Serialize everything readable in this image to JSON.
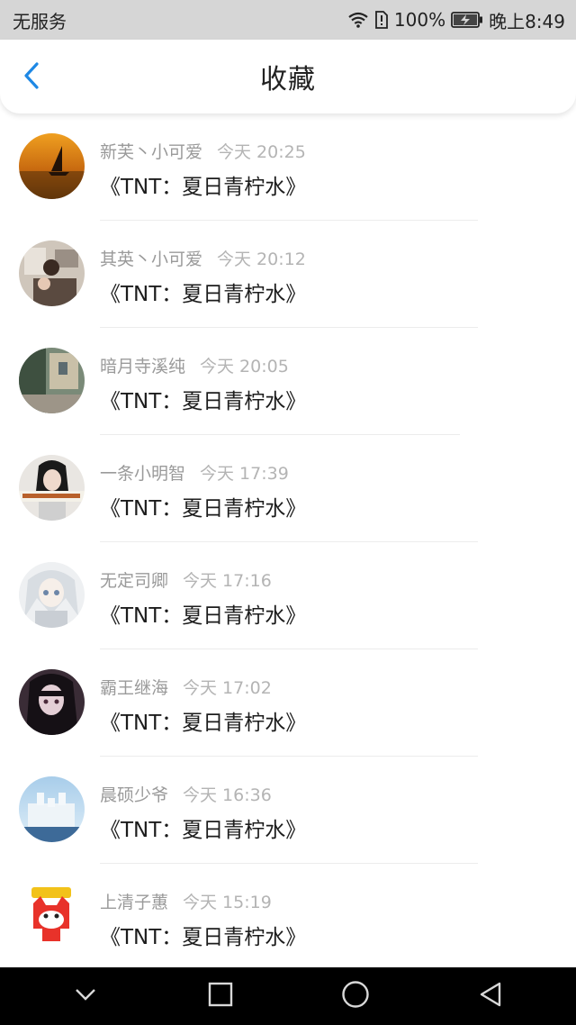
{
  "status_bar": {
    "carrier": "无服务",
    "battery": "100%",
    "time": "晚上8:49"
  },
  "header": {
    "title": "收藏",
    "back_icon": "chevron-left-icon",
    "accent": "#1e88e5"
  },
  "favorites": [
    {
      "user": "新芙丶小可爱",
      "time": "今天 20:25",
      "title": "《TNT：夏日青柠水》",
      "avatar": "sunset-sailboat"
    },
    {
      "user": "其英丶小可爱",
      "time": "今天 20:12",
      "title": "《TNT：夏日青柠水》",
      "avatar": "room-photo"
    },
    {
      "user": "暗月寺溪纯",
      "time": "今天 20:05",
      "title": "《TNT：夏日青柠水》",
      "avatar": "street-photo"
    },
    {
      "user": "一条小明智",
      "time": "今天 17:39",
      "title": "《TNT：夏日青柠水》",
      "avatar": "girl-caption"
    },
    {
      "user": "无定司卿",
      "time": "今天 17:16",
      "title": "《TNT：夏日青柠水》",
      "avatar": "anime-white-hair"
    },
    {
      "user": "霸王继海",
      "time": "今天 17:02",
      "title": "《TNT：夏日青柠水》",
      "avatar": "anime-dark-hair"
    },
    {
      "user": "晨硕少爷",
      "time": "今天 16:36",
      "title": "《TNT：夏日青柠水》",
      "avatar": "castle-sky"
    },
    {
      "user": "上清子蕙",
      "time": "今天 15:19",
      "title": "《TNT：夏日青柠水》",
      "avatar": "cartoon-fox"
    }
  ],
  "system_nav": {
    "buttons": [
      "chevron-down-icon",
      "square-icon",
      "circle-icon",
      "triangle-back-icon"
    ]
  }
}
